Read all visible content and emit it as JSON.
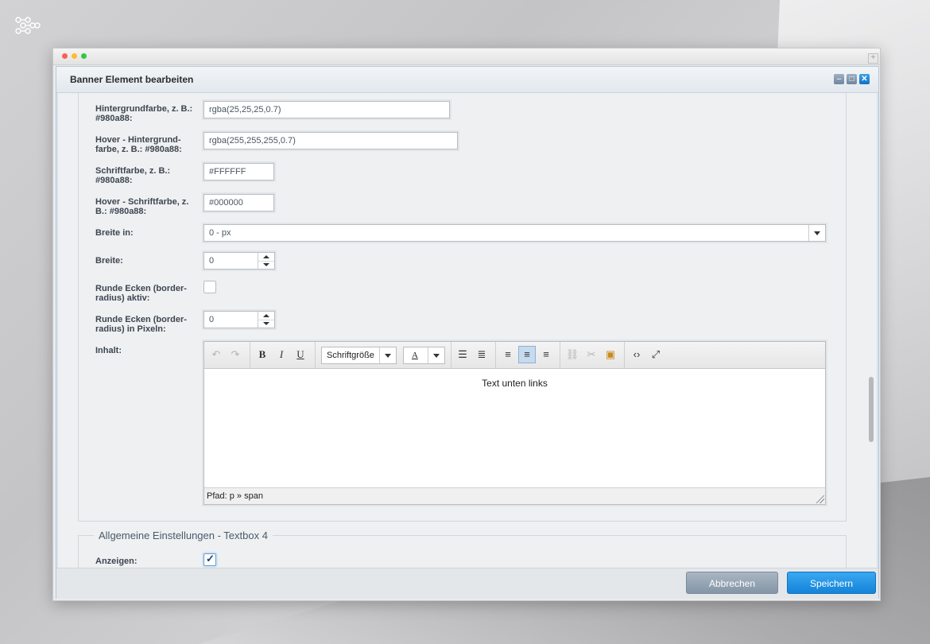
{
  "window": {
    "title": "Banner Element bearbeiten"
  },
  "form": {
    "bg_color": {
      "label": "Hintergrundfarbe, z. B.: #980a88:",
      "value": "rgba(25,25,25,0.7)"
    },
    "hover_bg_color": {
      "label": "Hover - Hintergrund-farbe, z. B.: #980a88:",
      "value": "rgba(255,255,255,0.7)"
    },
    "font_color": {
      "label": "Schriftfarbe, z. B.: #980a88:",
      "value": "#FFFFFF"
    },
    "hover_font_color": {
      "label": "Hover - Schriftfarbe, z. B.: #980a88:",
      "value": "#000000"
    },
    "width_unit": {
      "label": "Breite in:",
      "value": "0 - px"
    },
    "width": {
      "label": "Breite:",
      "value": "0"
    },
    "rounded_active": {
      "label": "Runde Ecken (border-radius) aktiv:",
      "checked": false
    },
    "rounded_px": {
      "label": "Runde Ecken (border-radius) in Pixeln:",
      "value": "0"
    },
    "content": {
      "label": "Inhalt:",
      "font_size_label": "Schriftgröße",
      "font_color_glyph": "A",
      "text": "Text unten links",
      "path": "Pfad: p » span"
    }
  },
  "section2": {
    "legend": "Allgemeine Einstellungen - Textbox 4",
    "show": {
      "label": "Anzeigen:",
      "checked": true
    }
  },
  "footer": {
    "cancel": "Abbrechen",
    "save": "Speichern"
  },
  "colors": {
    "accent": "#1a8ae0",
    "cancel": "#8e9eaf"
  },
  "icons": [
    "undo-icon",
    "redo-icon",
    "bold-icon",
    "italic-icon",
    "underline-icon",
    "bullet-list-icon",
    "numbered-list-icon",
    "align-left-icon",
    "align-center-icon",
    "align-right-icon",
    "link-icon",
    "unlink-icon",
    "image-icon",
    "source-code-icon",
    "fullscreen-icon"
  ]
}
